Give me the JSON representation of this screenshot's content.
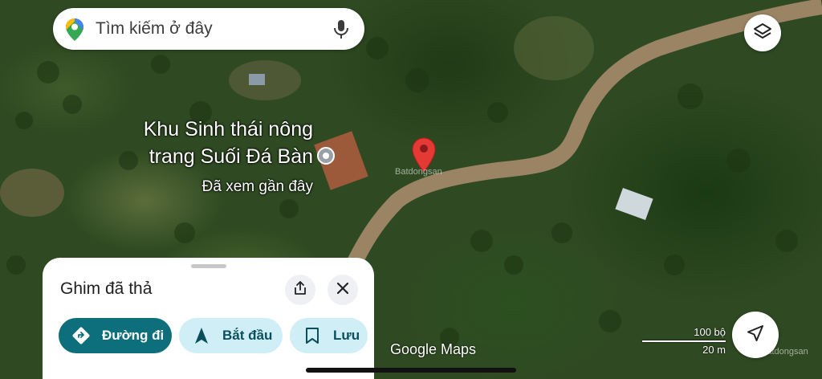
{
  "search": {
    "placeholder": "Tìm kiếm ở đây",
    "logo_icon": "google-maps-pin-icon",
    "mic_icon": "microphone-icon"
  },
  "map": {
    "place_name_line1": "Khu Sinh thái nông",
    "place_name_line2": "trang Suối Đá Bàn",
    "place_subtitle": "Đã xem gần đây",
    "place_icon": "location-pin-outline-icon",
    "dropped_pin_icon": "red-pin-icon",
    "watermark_top": "Batdongsan",
    "watermark_bottom": "Batdongsan",
    "brand": "Google Maps",
    "scale_top": "100 bộ",
    "scale_bottom": "20 m",
    "layers_icon": "layers-icon",
    "nav_icon": "navigation-arrow-icon"
  },
  "sheet": {
    "title": "Ghim đã thả",
    "share_icon": "share-icon",
    "close_icon": "close-icon",
    "directions_label": "Đường đi",
    "start_label": "Bắt đầu",
    "save_label": "Lưu"
  },
  "colors": {
    "accent": "#0d6e7c",
    "chip_light": "#cfeef5",
    "pin_red": "#e53935"
  }
}
